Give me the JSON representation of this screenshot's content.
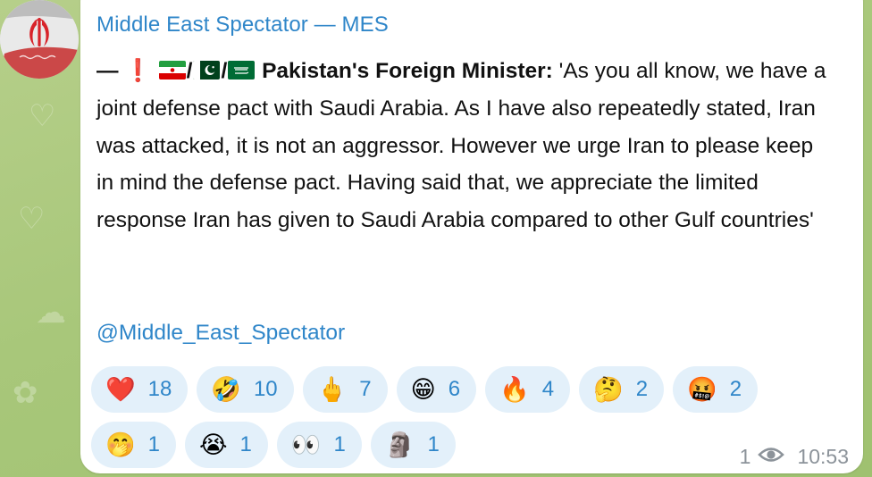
{
  "channel": {
    "name": "Middle East Spectator — MES"
  },
  "message": {
    "lead_dash": "—",
    "exclamation": "❗",
    "flags": [
      "iran-flag",
      "pakistan-flag",
      "saudi-arabia-flag"
    ],
    "separator": "/",
    "speaker": "Pakistan's Foreign Minister:",
    "body": " 'As you all know, we have a joint defense pact with Saudi Arabia. As I have also repeatedly stated, Iran was attacked, it is not an aggressor. However we urge Iran to please keep in mind the defense pact. Having said that, we appreciate the limited response Iran has given to Saudi Arabia compared to other Gulf countries'",
    "mention": "@Middle_East_Spectator"
  },
  "reactions": [
    [
      {
        "emoji": "❤️",
        "icon": "red-heart-icon",
        "count": "18"
      },
      {
        "emoji": "🤣",
        "icon": "rolling-on-floor-laughing-icon",
        "count": "10"
      },
      {
        "emoji": "🖕",
        "icon": "middle-finger-icon",
        "count": "7"
      },
      {
        "emoji": "😁",
        "icon": "beaming-face-icon",
        "count": "6"
      },
      {
        "emoji": "🔥",
        "icon": "fire-icon",
        "count": "4"
      },
      {
        "emoji": "🤔",
        "icon": "thinking-face-icon",
        "count": "2"
      },
      {
        "emoji": "🤬",
        "icon": "face-with-symbols-icon",
        "count": "2"
      }
    ],
    [
      {
        "emoji": "🤭",
        "icon": "face-with-hand-over-mouth-icon",
        "count": "1"
      },
      {
        "emoji": "😭",
        "icon": "loudly-crying-face-icon",
        "count": "1"
      },
      {
        "emoji": "👀",
        "icon": "eyes-icon",
        "count": "1"
      },
      {
        "emoji": "🗿",
        "icon": "moai-icon",
        "count": "1"
      }
    ]
  ],
  "meta": {
    "views": "1",
    "time": "10:53"
  },
  "colors": {
    "link": "#2f86c9",
    "reaction_bg": "#e3f0fa",
    "meta_text": "#8c939a",
    "bubble_bg": "#ffffff"
  }
}
